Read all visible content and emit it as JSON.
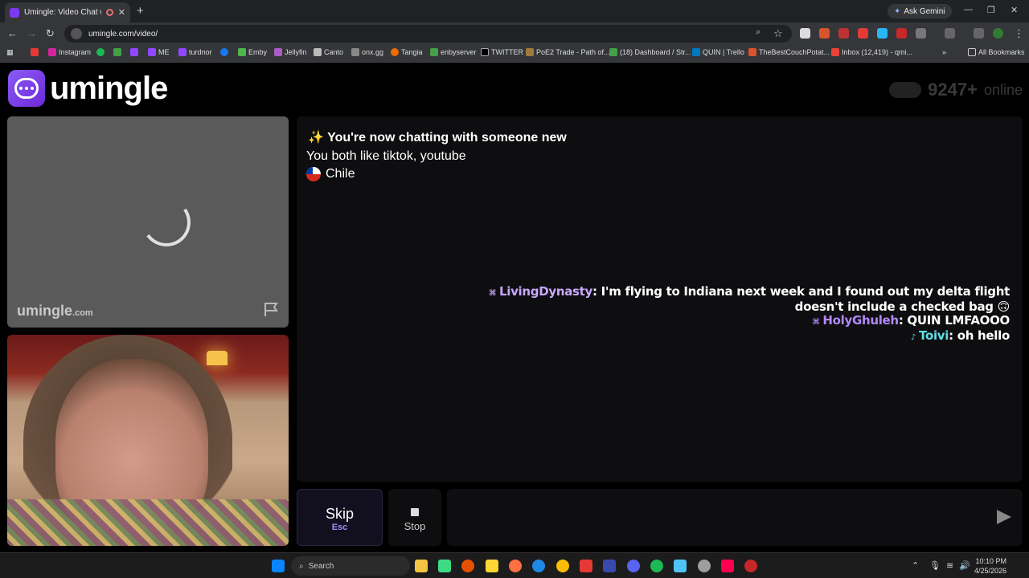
{
  "browser": {
    "tab_title": "Umingle: Video Chat with S",
    "tab_close": "✕",
    "new_tab": "+",
    "ask_gemini": "Ask Gemini",
    "window_minimize": "—",
    "window_restore": "❐",
    "window_close": "✕",
    "url": "umingle.com/video/",
    "bookmarks": [
      "Instagram",
      "ME",
      "turdnor",
      "Emby",
      "Jellyfin",
      "Canto",
      "onx.gg",
      "Tangia",
      "enbyserver",
      "TWITTER",
      "PoE2 Trade - Path of...",
      "(18) Dashboard / Str...",
      "QUIN | Trello",
      "TheBestCouchPotat...",
      "Inbox (12,419) - qmi..."
    ],
    "all_bookmarks": "All Bookmarks"
  },
  "site": {
    "logo_text": "umingle",
    "online_count": "9247+",
    "online_label": "online",
    "watermark": "umingle",
    "watermark_suffix": ".com"
  },
  "chat": {
    "system": {
      "new_chat": "✨ You're now chatting with someone new",
      "interests": "You both like tiktok, youtube",
      "country": "Chile"
    },
    "messages": [
      {
        "prefix": "⌘",
        "user": "LivingDynasty",
        "text": ": I'm flying to Indiana next week and I found out my delta flight doesn't include a checked bag 🙃"
      },
      {
        "prefix": "⌘",
        "user": "HolyGhuleh",
        "text": ": QUIN LMFAOOO"
      },
      {
        "prefix": "♪",
        "user": "Toivi",
        "text": ": oh hello"
      }
    ]
  },
  "controls": {
    "skip_label": "Skip",
    "skip_key": "Esc",
    "stop_label": "Stop",
    "input_placeholder": ""
  },
  "taskbar": {
    "search": "Search",
    "time": "10:10 PM",
    "date": "4/25/2026"
  }
}
